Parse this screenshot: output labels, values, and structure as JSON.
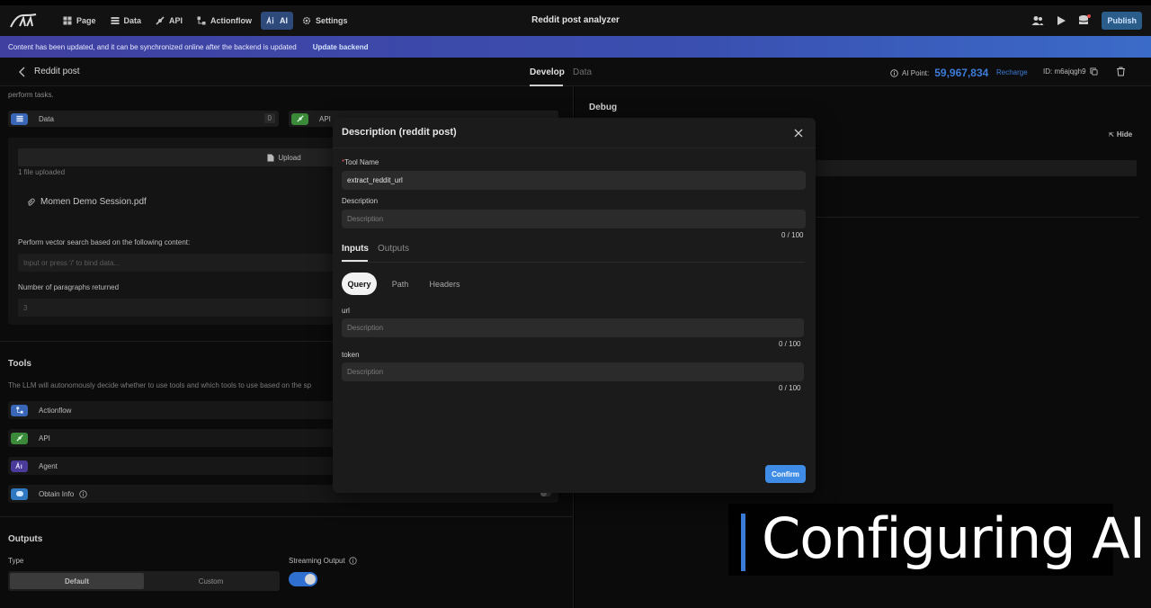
{
  "nav": {
    "items": [
      {
        "label": "Page",
        "icon": "page-icon"
      },
      {
        "label": "Data",
        "icon": "data-icon"
      },
      {
        "label": "API",
        "icon": "api-icon"
      },
      {
        "label": "Actionflow",
        "icon": "actionflow-icon"
      },
      {
        "label": "AI",
        "icon": "ai-icon",
        "active": true
      },
      {
        "label": "Settings",
        "icon": "gear-icon"
      }
    ],
    "title": "Reddit post analyzer",
    "publish": "Publish"
  },
  "banner": {
    "message": "Content has been updated, and it can be synchronized online after the backend is updated",
    "action": "Update backend"
  },
  "subheader": {
    "title": "Reddit post",
    "tab_develop": "Develop",
    "tab_data": "Data",
    "ai_point_label": "AI Point:",
    "ai_point_value": "59,967,834",
    "recharge": "Recharge",
    "id": "ID: m6ajqgh9"
  },
  "left": {
    "perform_text": "perform tasks.",
    "data_chip": {
      "label": "Data",
      "count": "0"
    },
    "api_chip": {
      "label": "API"
    },
    "upload": "Upload",
    "files_uploaded": "1 file uploaded",
    "file_name": "Momen Demo Session.pdf",
    "vector_label": "Perform vector search based on the following content:",
    "vector_placeholder": "Input or press '/' to bind data...",
    "paragraphs_label": "Number of paragraphs returned",
    "paragraphs_value": "3",
    "tools_title": "Tools",
    "tools_desc": "The LLM will autonomously decide whether to use tools and which tools to use based on the sp",
    "tools": [
      {
        "label": "Actionflow"
      },
      {
        "label": "API"
      },
      {
        "label": "Agent"
      },
      {
        "label": "Obtain Info"
      }
    ],
    "outputs_title": "Outputs",
    "type_label": "Type",
    "type_default": "Default",
    "type_custom": "Custom",
    "streaming_label": "Streaming Output"
  },
  "right": {
    "debug": "Debug",
    "hide": "Hide"
  },
  "modal": {
    "title": "Description (reddit post)",
    "tool_name_label": "Tool Name",
    "tool_name_value": "extract_reddit_url",
    "description_label": "Description",
    "description_placeholder": "Description",
    "description_count": "0 / 100",
    "tab_inputs": "Inputs",
    "tab_outputs": "Outputs",
    "pill_query": "Query",
    "pill_path": "Path",
    "pill_headers": "Headers",
    "params": [
      {
        "name": "url",
        "placeholder": "Description",
        "count": "0 / 100"
      },
      {
        "name": "token",
        "placeholder": "Description",
        "count": "0 / 100"
      }
    ],
    "confirm": "Confirm"
  },
  "caption": "Configuring AI",
  "colors": {
    "accent": "#3c7bd8",
    "confirm": "#3f8ce6",
    "banner_start": "#4040a0",
    "banner_end": "#3b6bc8"
  }
}
